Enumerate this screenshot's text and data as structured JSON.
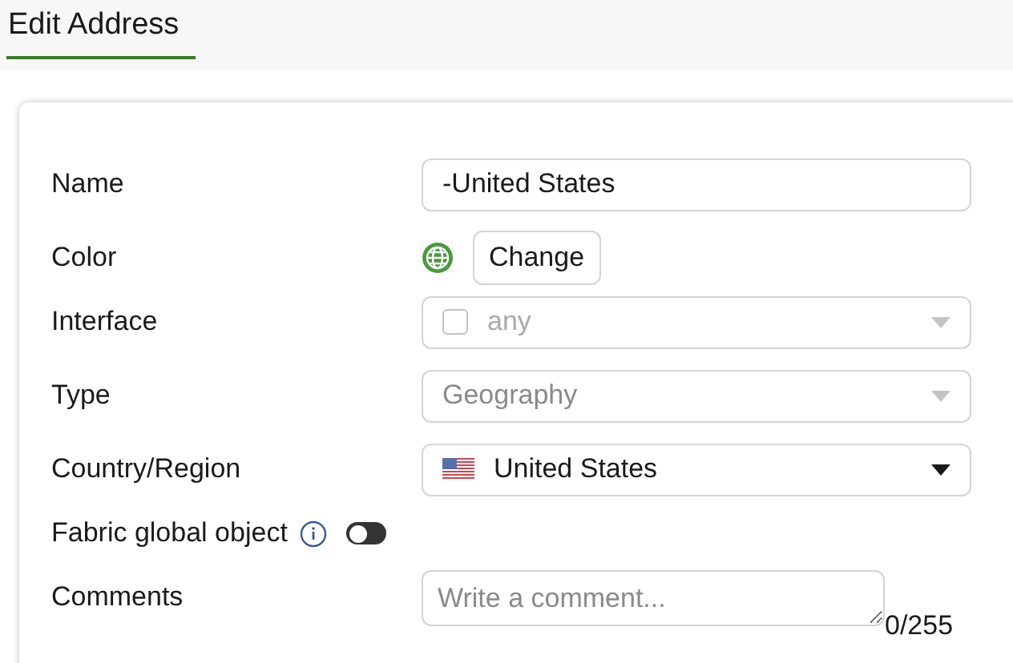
{
  "header": {
    "title": "Edit Address"
  },
  "fields": [
    {
      "kind": "text",
      "label": "Name",
      "value": "-United States"
    },
    {
      "kind": "color",
      "label": "Color",
      "button": "Change"
    },
    {
      "kind": "checkselect",
      "label": "Interface",
      "value": "any",
      "checked": false,
      "disabled": true
    },
    {
      "kind": "select",
      "label": "Type",
      "value": "Geography",
      "disabled": true
    },
    {
      "kind": "flagselect",
      "label": "Country/Region",
      "value": "United States",
      "disabled": false
    },
    {
      "kind": "toggle",
      "label": "Fabric global object",
      "on": false
    },
    {
      "kind": "textarea",
      "label": "Comments",
      "placeholder": "Write a comment...",
      "counter": "0/255"
    }
  ]
}
